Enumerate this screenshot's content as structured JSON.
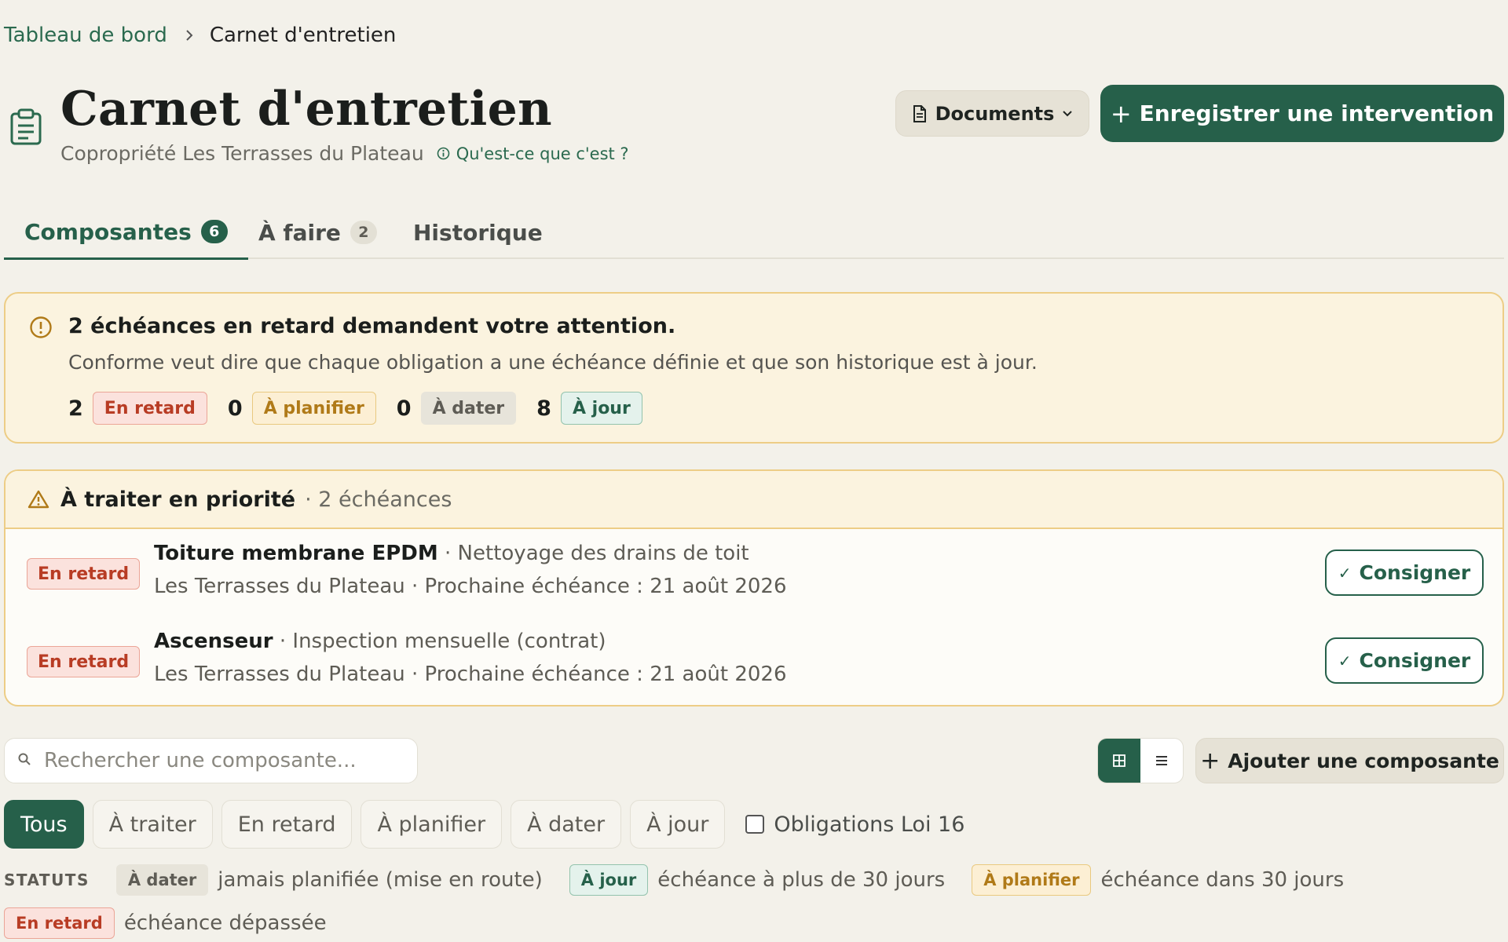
{
  "breadcrumb": {
    "root": "Tableau de bord",
    "current": "Carnet d'entretien"
  },
  "header": {
    "title": "Carnet d'entretien",
    "subtitle": "Copropriété Les Terrasses du Plateau",
    "help_link": "Qu'est-ce que c'est ?",
    "documents_button": "Documents",
    "primary_button": "Enregistrer une intervention"
  },
  "tabs": [
    {
      "label": "Composantes",
      "count": "6",
      "active": true
    },
    {
      "label": "À faire",
      "count": "2",
      "active": false
    },
    {
      "label": "Historique",
      "count": "",
      "active": false
    }
  ],
  "alert": {
    "title": "2 échéances en retard demandent votre attention.",
    "text": "Conforme veut dire que chaque obligation a une échéance définie et que son historique est à jour.",
    "stats": [
      {
        "count": "2",
        "label": "En retard",
        "status": "retard"
      },
      {
        "count": "0",
        "label": "À planifier",
        "status": "planifier"
      },
      {
        "count": "0",
        "label": "À dater",
        "status": "dater"
      },
      {
        "count": "8",
        "label": "À jour",
        "status": "jour"
      }
    ]
  },
  "priority": {
    "title": "À traiter en priorité",
    "count_text": "· 2 échéances",
    "items": [
      {
        "status": "En retard",
        "name": "Toiture membrane EPDM",
        "task": "· Nettoyage des drains de toit",
        "detail": "Les Terrasses du Plateau · Prochaine échéance : 21 août 2026",
        "action": "Consigner"
      },
      {
        "status": "En retard",
        "name": "Ascenseur",
        "task": "· Inspection mensuelle (contrat)",
        "detail": "Les Terrasses du Plateau · Prochaine échéance : 21 août 2026",
        "action": "Consigner"
      }
    ]
  },
  "search": {
    "placeholder": "Rechercher une composante..."
  },
  "add_button": "Ajouter une composante",
  "filters": [
    {
      "label": "Tous",
      "active": true
    },
    {
      "label": "À traiter",
      "active": false
    },
    {
      "label": "En retard",
      "active": false
    },
    {
      "label": "À planifier",
      "active": false
    },
    {
      "label": "À dater",
      "active": false
    },
    {
      "label": "À jour",
      "active": false
    }
  ],
  "law_checkbox": {
    "label": "Obligations Loi 16",
    "checked": false
  },
  "legend": {
    "label": "STATUTS",
    "items": [
      {
        "badge": "À dater",
        "desc": "jamais planifiée (mise en route)"
      },
      {
        "badge": "À jour",
        "desc": "échéance à plus de 30 jours"
      },
      {
        "badge": "À planifier",
        "desc": "échéance dans 30 jours"
      },
      {
        "badge": "En retard",
        "desc": "échéance dépassée"
      }
    ]
  },
  "colors": {
    "brand_green": "#26604a",
    "background": "#f3f1ea",
    "warning_border": "#edcd86",
    "danger": "#b83c24"
  }
}
